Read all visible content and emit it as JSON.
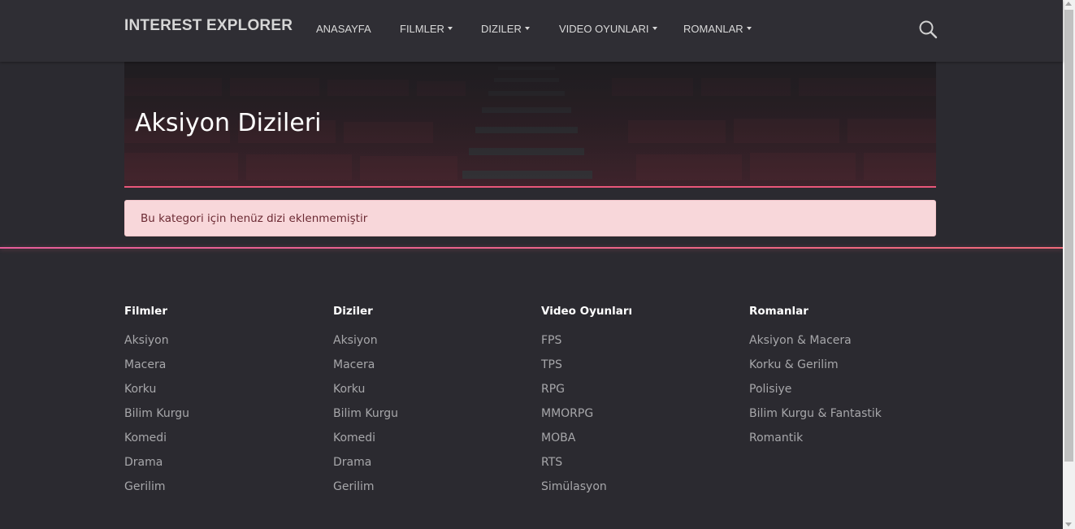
{
  "navbar": {
    "brand": "INTEREST EXPLORER",
    "items": [
      {
        "label": "ANASAYFA",
        "dropdown": false
      },
      {
        "label": "FILMLER",
        "dropdown": true
      },
      {
        "label": "DIZILER",
        "dropdown": true
      },
      {
        "label": "VIDEO OYUNLARI",
        "dropdown": true
      },
      {
        "label": "ROMANLAR",
        "dropdown": true
      }
    ],
    "search_icon": "search-icon"
  },
  "hero": {
    "title": "Aksiyon Dizileri"
  },
  "alert": {
    "message": "Bu kategori için henüz dizi eklenmemiştir"
  },
  "footer": {
    "columns": [
      {
        "heading": "Filmler",
        "links": [
          "Aksiyon",
          "Macera",
          "Korku",
          "Bilim Kurgu",
          "Komedi",
          "Drama",
          "Gerilim"
        ]
      },
      {
        "heading": "Diziler",
        "links": [
          "Aksiyon",
          "Macera",
          "Korku",
          "Bilim Kurgu",
          "Komedi",
          "Drama",
          "Gerilim"
        ]
      },
      {
        "heading": "Video Oyunları",
        "links": [
          "FPS",
          "TPS",
          "RPG",
          "MMORPG",
          "MOBA",
          "RTS",
          "Simülasyon"
        ]
      },
      {
        "heading": "Romanlar",
        "links": [
          "Aksiyon & Macera",
          "Korku & Gerilim",
          "Polisiye",
          "Bilim Kurgu & Fantastik",
          "Romantik"
        ]
      }
    ]
  },
  "colors": {
    "background": "#2b2a30",
    "navbar": "#2f2e34",
    "accent_line": "#e8577a",
    "alert_bg": "#f8d7da",
    "alert_text": "#6b2a33"
  }
}
